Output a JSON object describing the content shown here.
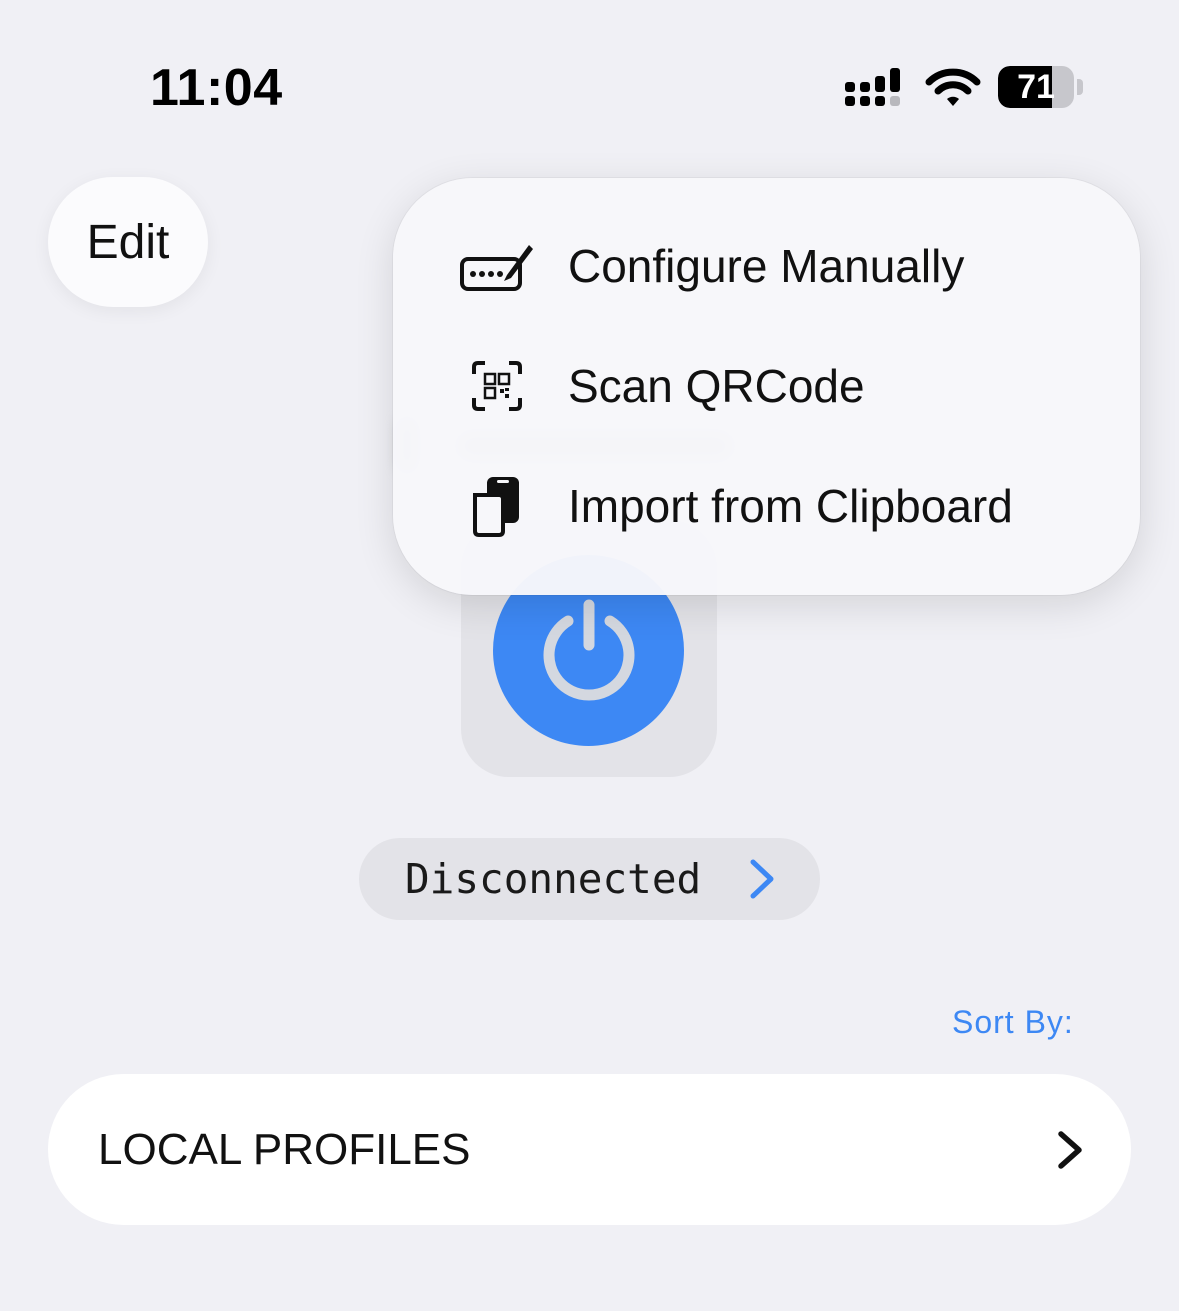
{
  "status_bar": {
    "time": "11:04",
    "battery_percent": "71",
    "battery_level": 0.71
  },
  "toolbar": {
    "edit_label": "Edit"
  },
  "menu": {
    "items": [
      {
        "label": "Configure Manually",
        "icon": "keyboard-pencil-icon"
      },
      {
        "label": "Scan QRCode",
        "icon": "qrcode-viewfinder-icon"
      },
      {
        "label": "Import from Clipboard",
        "icon": "clipboard-copy-icon"
      }
    ]
  },
  "connection": {
    "power_icon": "power-icon",
    "status": "Disconnected",
    "accent_color": "#3d88f4"
  },
  "profiles": {
    "sort_label": "Sort By:",
    "section_label": "LOCAL PROFILES"
  }
}
